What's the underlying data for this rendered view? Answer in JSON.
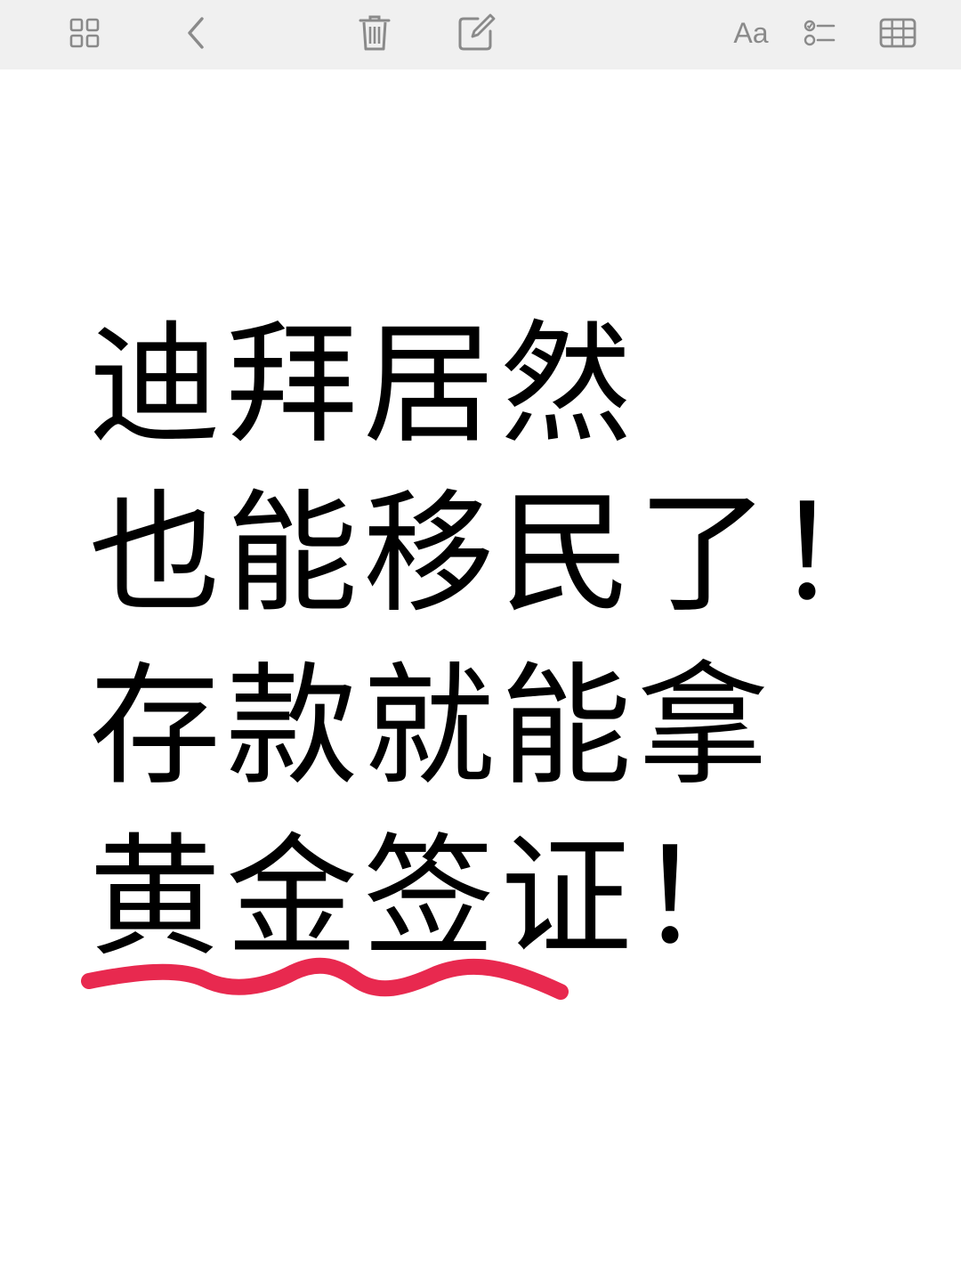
{
  "toolbar": {
    "buttons": [
      {
        "name": "gallery-view-icon"
      },
      {
        "name": "back-chevron-icon"
      },
      {
        "name": "trash-icon"
      },
      {
        "name": "compose-icon"
      },
      {
        "name": "text-format-button",
        "label": "Aa"
      },
      {
        "name": "checklist-icon"
      },
      {
        "name": "table-icon"
      }
    ],
    "format_label": "Aa"
  },
  "note": {
    "lines": [
      "迪拜居然",
      "也能移民了！",
      "存款就能拿",
      "黄金签证！"
    ]
  },
  "colors": {
    "toolbar_bg": "#f0f0f0",
    "icon": "#8a8a8a",
    "text": "#000000",
    "highlight_underline": "#e8294f"
  }
}
